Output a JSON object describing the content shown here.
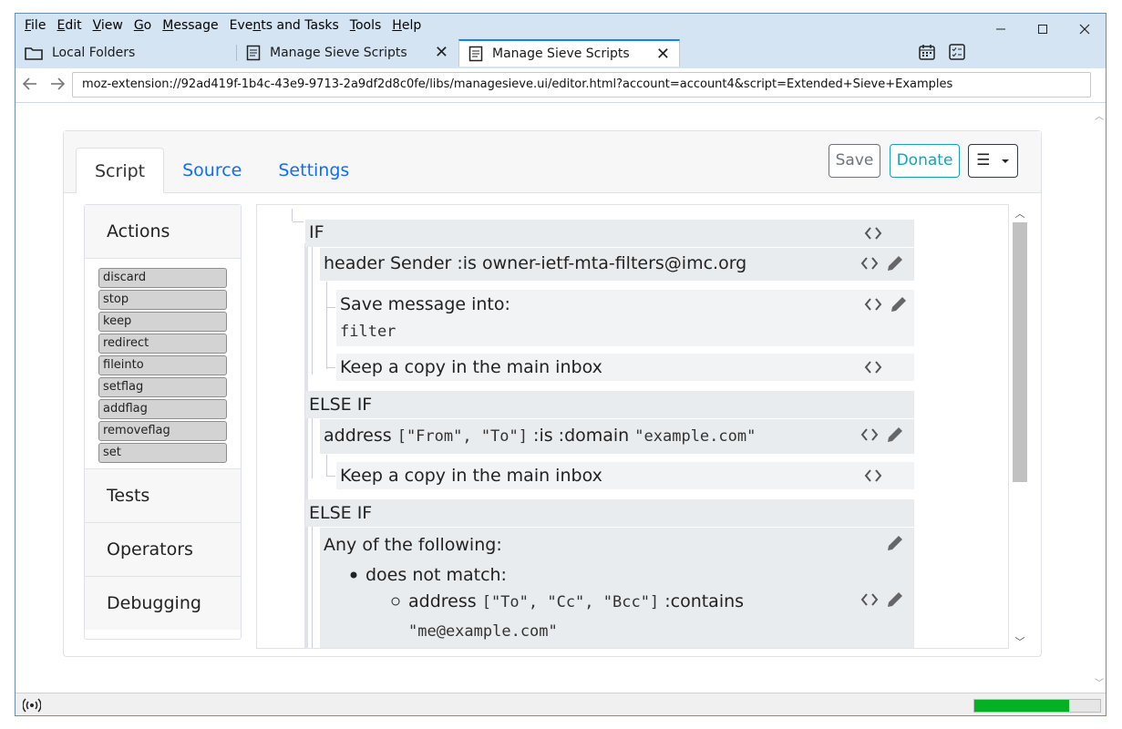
{
  "menu": [
    {
      "label": "File",
      "u": "F",
      "rest": "ile"
    },
    {
      "label": "Edit",
      "u": "E",
      "rest": "dit"
    },
    {
      "label": "View",
      "u": "V",
      "rest": "iew"
    },
    {
      "label": "Go",
      "u": "G",
      "rest": "o"
    },
    {
      "label": "Message",
      "u": "M",
      "rest": "essage"
    },
    {
      "label": "Events and Tasks",
      "pre": "Eve",
      "u": "n",
      "rest": "ts and Tasks"
    },
    {
      "label": "Tools",
      "u": "T",
      "rest": "ools"
    },
    {
      "label": "Help",
      "u": "H",
      "rest": "elp"
    }
  ],
  "tabs": [
    {
      "label": "Local Folders"
    },
    {
      "label": "Manage Sieve Scripts"
    },
    {
      "label": "Manage Sieve Scripts"
    }
  ],
  "url": "moz-extension://92ad419f-1b4c-43e9-9713-2a9df2d8c0fe/libs/managesieve.ui/editor.html?account=account4&script=Extended+Sieve+Examples",
  "editor_tabs": {
    "script": "Script",
    "source": "Source",
    "settings": "Settings"
  },
  "buttons": {
    "save": "Save",
    "donate": "Donate",
    "menu": "☰"
  },
  "sidebar": {
    "actions_title": "Actions",
    "actions": [
      "discard",
      "stop",
      "keep",
      "redirect",
      "fileinto",
      "setflag",
      "addflag",
      "removeflag",
      "set"
    ],
    "tests": "Tests",
    "operators": "Operators",
    "debugging": "Debugging"
  },
  "script": {
    "if": "IF",
    "header_test": "header Sender :is owner-ietf-mta-filters@imc.org",
    "save_into": "Save message into:",
    "folder": "filter",
    "keep_copy_1": "Keep a copy in the main inbox",
    "elseif_1": "ELSE IF",
    "addr_prefix": "address",
    "addr_list": "[\"From\", \"To\"]",
    "addr_mid": ":is :domain",
    "addr_value": "\"example.com\"",
    "keep_copy_2": "Keep a copy in the main inbox",
    "elseif_2": "ELSE IF",
    "any_of": "Any of the following:",
    "does_not_match": "does not match:",
    "addr2_prefix": "address",
    "addr2_list": "[\"To\", \"Cc\", \"Bcc\"]",
    "addr2_mid": ":contains",
    "addr2_value": "\"me@example.com\""
  },
  "progress": 0.75,
  "colors": {
    "accent": "#0a84ff",
    "progress": "#06b025",
    "link": "#0d6efd",
    "donate": "#17a2b8"
  }
}
